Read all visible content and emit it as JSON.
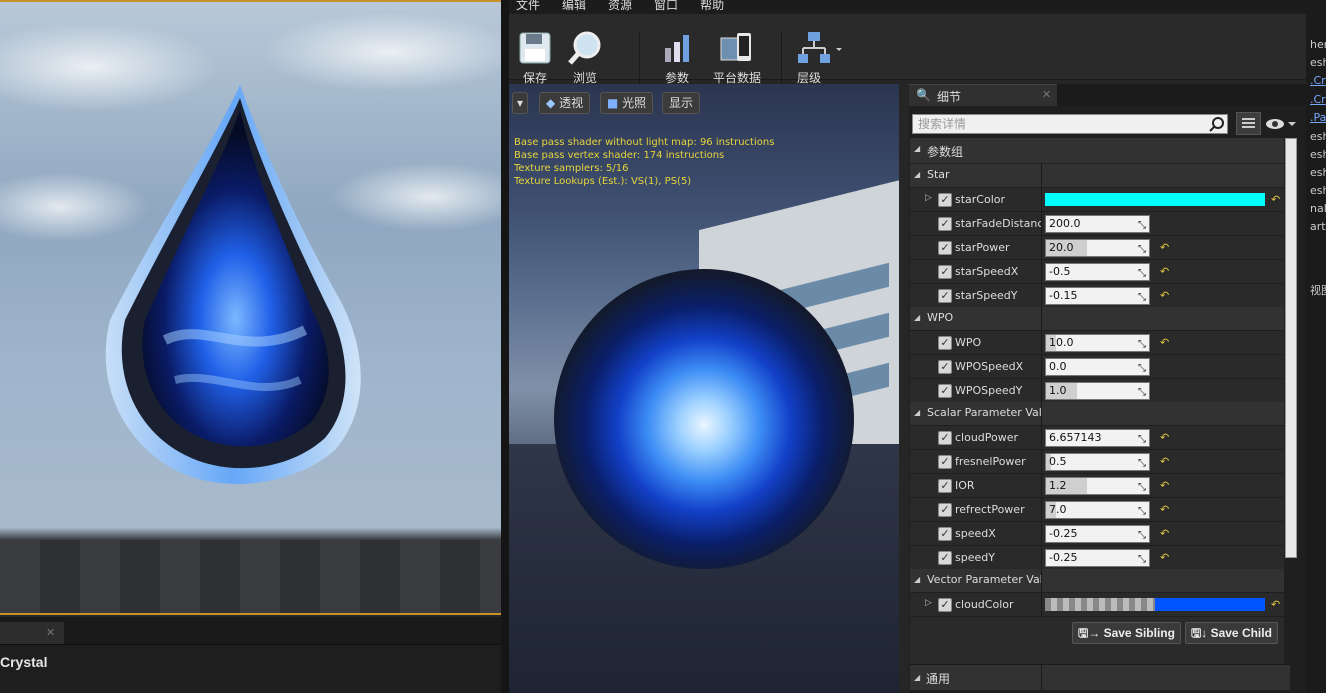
{
  "menu": [
    "文件",
    "编辑",
    "资源",
    "窗口",
    "帮助"
  ],
  "toolbar": {
    "save": "保存",
    "browse": "浏览",
    "params": "参数",
    "platform": "平台数据",
    "hierarchy": "层级"
  },
  "left_panel": {
    "title": "Crystal"
  },
  "viewport": {
    "perspective": "透视",
    "lit": "光照",
    "show": "显示",
    "stats": [
      "Base pass shader without light map: 96 instructions",
      "Base pass vertex shader: 174 instructions",
      "Texture samplers: 5/16",
      "Texture Lookups (Est.): VS(1), PS(5)"
    ]
  },
  "details": {
    "tab": "细节",
    "search_placeholder": "搜索详情",
    "param_group": "参数组",
    "general": "通用",
    "save_sibling": "Save Sibling",
    "save_child": "Save Child",
    "groups": [
      {
        "name": "Star"
      },
      {
        "name": "WPO"
      },
      {
        "name": "Scalar Parameter Values"
      },
      {
        "name": "Vector Parameter Values"
      }
    ],
    "params": {
      "starColor": {
        "label": "starColor",
        "color": "#00ffff"
      },
      "starFadeDistance": {
        "label": "starFadeDistance",
        "value": "200.0",
        "fill": 0
      },
      "starPower": {
        "label": "starPower",
        "value": "20.0",
        "fill": 0.4
      },
      "starSpeedX": {
        "label": "starSpeedX",
        "value": "-0.5",
        "fill": 0
      },
      "starSpeedY": {
        "label": "starSpeedY",
        "value": "-0.15",
        "fill": 0
      },
      "WPO": {
        "label": "WPO",
        "value": "10.0",
        "fill": 0.1
      },
      "WPOSpeedX": {
        "label": "WPOSpeedX",
        "value": "0.0",
        "fill": 0
      },
      "WPOSpeedY": {
        "label": "WPOSpeedY",
        "value": "1.0",
        "fill": 0.3
      },
      "cloudPower": {
        "label": "cloudPower",
        "value": "6.657143",
        "fill": 0
      },
      "fresnelPower": {
        "label": "fresnelPower",
        "value": "0.5",
        "fill": 0.05
      },
      "IOR": {
        "label": "IOR",
        "value": "1.2",
        "fill": 0.4
      },
      "refrectPower": {
        "label": "refrectPower",
        "value": "7.0",
        "fill": 0.1
      },
      "speedX": {
        "label": "speedX",
        "value": "-0.25",
        "fill": 0
      },
      "speedY": {
        "label": "speedY",
        "value": "-0.25",
        "fill": 0
      },
      "cloudColor": {
        "label": "cloudColor",
        "color": "#0055ff"
      }
    }
  },
  "right_strip": [
    "her",
    "esh",
    ".Cr",
    ".Cr",
    ".Pa",
    "esh",
    "esh",
    "esh",
    "esh",
    "nali",
    "art",
    "视图"
  ]
}
